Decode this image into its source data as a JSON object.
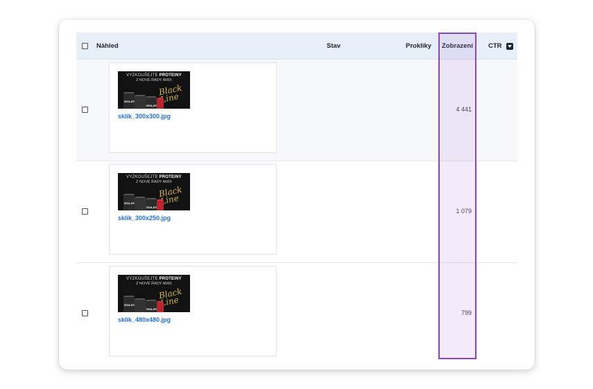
{
  "table": {
    "columns": {
      "preview": "Náhled",
      "status": "Stav",
      "clicks": "Prokliky",
      "impressions": "Zobrazení",
      "ctr": "CTR"
    },
    "sort_icon": "caret-down-square-icon",
    "rows": [
      {
        "filename": "sklik_300x300.jpg",
        "status": "",
        "clicks": "",
        "impressions": "4 441",
        "ctr": ""
      },
      {
        "filename": "sklik_300x250.jpg",
        "status": "",
        "clicks": "",
        "impressions": "1 079",
        "ctr": ""
      },
      {
        "filename": "sklik_480x480.jpg",
        "status": "",
        "clicks": "",
        "impressions": "799",
        "ctr": ""
      }
    ]
  },
  "banner": {
    "line1_prefix": "VYZKOUŠEJTE",
    "line1_bold": "PROTEINY",
    "line2": "Z NOVÉ ŘADY AMIX",
    "script_line1": "Black",
    "script_line2": "Line",
    "product_label": "ISOLATE"
  },
  "colors": {
    "header_bg": "#e7eff9",
    "link": "#2470c4",
    "highlight_border": "#8b43c2"
  }
}
